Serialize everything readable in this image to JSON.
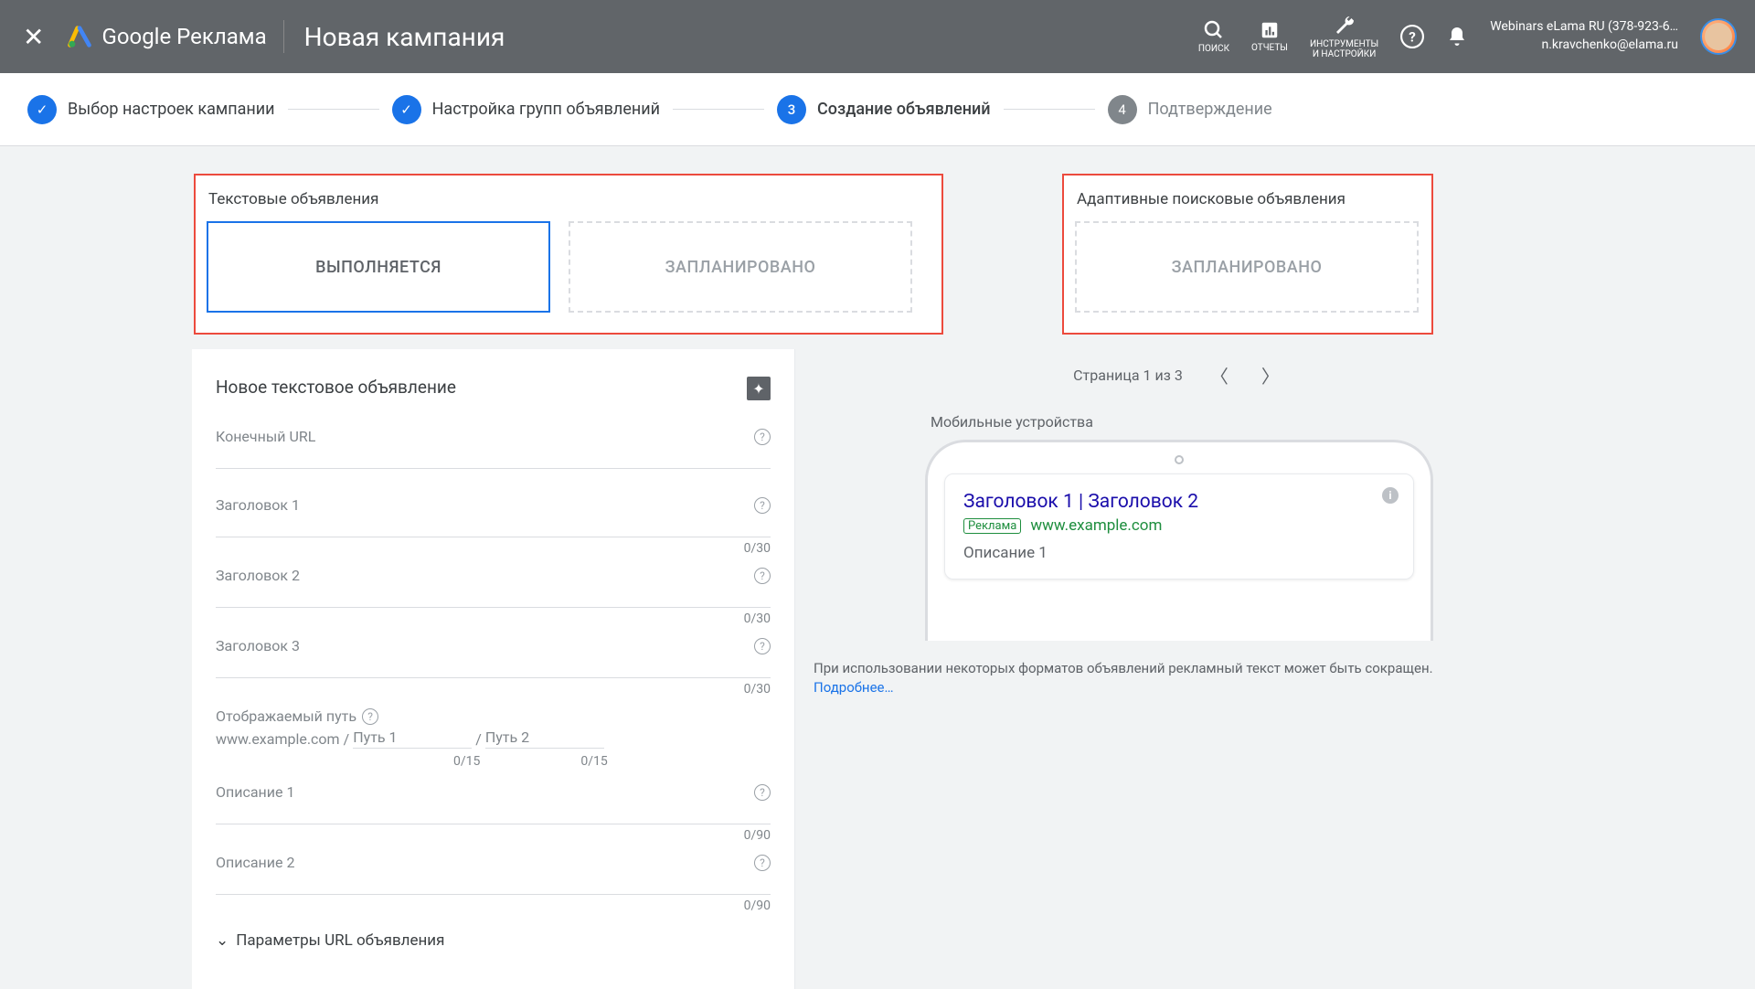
{
  "header": {
    "logo_text": "Google Реклама",
    "page_title": "Новая кампания",
    "search_label": "ПОИСК",
    "reports_label": "ОТЧЕТЫ",
    "tools_label": "ИНСТРУМЕНТЫ\nИ НАСТРОЙКИ",
    "user_line1": "Webinars eLama RU (378-923-6…",
    "user_line2": "n.kravchenko@elama.ru"
  },
  "stepper": {
    "step1": "Выбор настроек кампании",
    "step2": "Настройка групп объявлений",
    "step3_num": "3",
    "step3": "Создание объявлений",
    "step4_num": "4",
    "step4": "Подтверждение"
  },
  "ad_types": {
    "text_title": "Текстовые объявления",
    "tab_running": "ВЫПОЛНЯЕТСЯ",
    "tab_scheduled": "ЗАПЛАНИРОВАНО",
    "rsa_title": "Адаптивные поисковые объявления",
    "rsa_scheduled": "ЗАПЛАНИРОВАНО"
  },
  "form": {
    "heading": "Новое текстовое объявление",
    "final_url": "Конечный URL",
    "headline1": "Заголовок 1",
    "headline2": "Заголовок 2",
    "headline3": "Заголовок 3",
    "char30": "0/30",
    "display_path_label": "Отображаемый путь",
    "base_url": "www.example.com",
    "path1_placeholder": "Путь 1",
    "path2_placeholder": "Путь 2",
    "char15": "0/15",
    "description1": "Описание 1",
    "description2": "Описание 2",
    "char90": "0/90",
    "url_options": "Параметры URL объявления"
  },
  "preview": {
    "pager_text": "Страница 1 из 3",
    "device_label": "Мобильные устройства",
    "ad_headline": "Заголовок 1 | Заголовок 2",
    "ad_badge": "Реклама",
    "ad_url": "www.example.com",
    "ad_desc": "Описание 1",
    "disclaimer": "При использовании некоторых форматов объявлений рекламный текст может быть сокращен.",
    "learn_more": "Подробнее…"
  }
}
